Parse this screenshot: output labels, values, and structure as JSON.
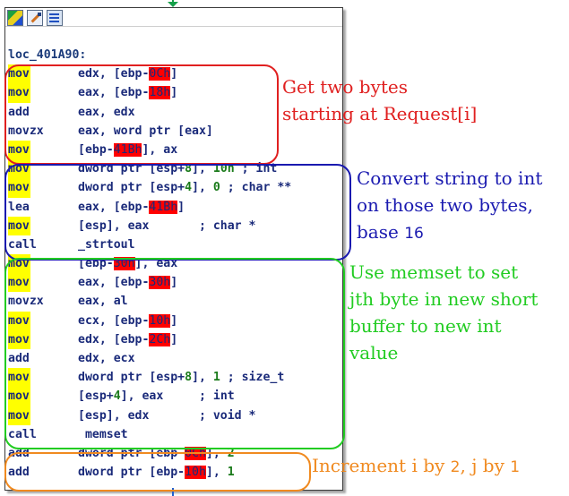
{
  "toolbar": {
    "icons": [
      "color-palette-icon",
      "rename-pencil-icon",
      "graph-overview-icon"
    ]
  },
  "code": {
    "label": "loc_401A90:",
    "lines": [
      {
        "mn": "mov",
        "hl": true,
        "parts": [
          [
            "op",
            "edx, [ebp-"
          ],
          [
            "red",
            "0Ch"
          ],
          [
            "op",
            "]"
          ]
        ]
      },
      {
        "mn": "mov",
        "hl": true,
        "parts": [
          [
            "op",
            "eax, [ebp-"
          ],
          [
            "red",
            "18h"
          ],
          [
            "op",
            "]"
          ]
        ]
      },
      {
        "mn": "add",
        "hl": false,
        "parts": [
          [
            "op",
            "eax, edx"
          ]
        ]
      },
      {
        "mn": "movzx",
        "hl": false,
        "parts": [
          [
            "op",
            "eax, word ptr [eax]"
          ]
        ]
      },
      {
        "mn": "mov",
        "hl": true,
        "parts": [
          [
            "op",
            "[ebp-"
          ],
          [
            "red",
            "41Bh"
          ],
          [
            "op",
            "], ax"
          ]
        ]
      },
      {
        "mn": "mov",
        "hl": true,
        "parts": [
          [
            "op",
            "dword ptr [esp+"
          ],
          [
            "num",
            "8"
          ],
          [
            "op",
            "], "
          ],
          [
            "num",
            "10h"
          ],
          [
            "cmt",
            " ; int"
          ]
        ]
      },
      {
        "mn": "mov",
        "hl": true,
        "parts": [
          [
            "op",
            "dword ptr [esp+"
          ],
          [
            "num",
            "4"
          ],
          [
            "op",
            "], "
          ],
          [
            "num",
            "0"
          ],
          [
            "cmt",
            " ; char **"
          ]
        ]
      },
      {
        "mn": "lea",
        "hl": false,
        "parts": [
          [
            "op",
            "eax, [ebp-"
          ],
          [
            "red",
            "41Bh"
          ],
          [
            "op",
            "]"
          ]
        ]
      },
      {
        "mn": "mov",
        "hl": true,
        "parts": [
          [
            "op",
            "[esp], eax"
          ],
          [
            "cmt",
            "       ; char *"
          ]
        ]
      },
      {
        "mn": "call",
        "hl": false,
        "parts": [
          [
            "op",
            "_strtoul"
          ]
        ]
      },
      {
        "mn": "mov",
        "hl": true,
        "parts": [
          [
            "op",
            "[ebp-"
          ],
          [
            "red",
            "30h"
          ],
          [
            "op",
            "], eax"
          ]
        ]
      },
      {
        "mn": "mov",
        "hl": true,
        "parts": [
          [
            "op",
            "eax, [ebp-"
          ],
          [
            "red",
            "30h"
          ],
          [
            "op",
            "]"
          ]
        ]
      },
      {
        "mn": "movzx",
        "hl": false,
        "parts": [
          [
            "op",
            "eax, al"
          ]
        ]
      },
      {
        "mn": "mov",
        "hl": true,
        "parts": [
          [
            "op",
            "ecx, [ebp-"
          ],
          [
            "red",
            "10h"
          ],
          [
            "op",
            "]"
          ]
        ]
      },
      {
        "mn": "mov",
        "hl": true,
        "parts": [
          [
            "op",
            "edx, [ebp-"
          ],
          [
            "red",
            "2Ch"
          ],
          [
            "op",
            "]"
          ]
        ]
      },
      {
        "mn": "add",
        "hl": false,
        "parts": [
          [
            "op",
            "edx, ecx"
          ]
        ]
      },
      {
        "mn": "mov",
        "hl": true,
        "parts": [
          [
            "op",
            "dword ptr [esp+"
          ],
          [
            "num",
            "8"
          ],
          [
            "op",
            "], "
          ],
          [
            "num",
            "1"
          ],
          [
            "cmt",
            " ; size_t"
          ]
        ]
      },
      {
        "mn": "mov",
        "hl": true,
        "parts": [
          [
            "op",
            "[esp+"
          ],
          [
            "num",
            "4"
          ],
          [
            "op",
            "], eax"
          ],
          [
            "cmt",
            "     ; int"
          ]
        ]
      },
      {
        "mn": "mov",
        "hl": true,
        "parts": [
          [
            "op",
            "[esp], edx"
          ],
          [
            "cmt",
            "       ; void *"
          ]
        ]
      },
      {
        "mn": "call",
        "hl": false,
        "parts": [
          [
            "op",
            " memset"
          ]
        ]
      },
      {
        "mn": "add",
        "hl": false,
        "parts": [
          [
            "op",
            "dword ptr [ebp-"
          ],
          [
            "red",
            "0Ch"
          ],
          [
            "op",
            "], "
          ],
          [
            "num",
            "2"
          ]
        ]
      },
      {
        "mn": "add",
        "hl": false,
        "parts": [
          [
            "op",
            "dword ptr [ebp-"
          ],
          [
            "red",
            "10h"
          ],
          [
            "op",
            "], "
          ],
          [
            "num",
            "1"
          ]
        ]
      }
    ]
  },
  "annotations": {
    "red": "Get two bytes\nstarting at Request[i]",
    "blue_pre": "Convert string to int\non those two bytes,\nbase ",
    "blue_num": "16",
    "green": "Use memset to set\njth byte in new short\nbuffer to new int\nvalue",
    "orange_a": "Increment i by ",
    "orange_n1": "2",
    "orange_b": ", j by ",
    "orange_n2": "1"
  },
  "colors": {
    "red_box": "#e02020",
    "blue_box": "#1a1ab0",
    "green_box": "#22cc22",
    "orange_box": "#f08a20",
    "mnemonic_highlight": "#ffff00",
    "offset_highlight": "#ff0000"
  }
}
